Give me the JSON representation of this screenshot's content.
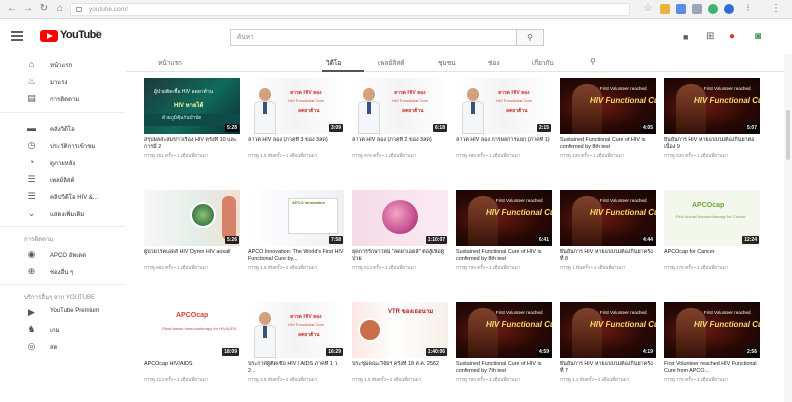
{
  "browser": {
    "url": "youtube.com/",
    "icons": [
      "back-icon",
      "forward-icon",
      "reload-icon",
      "home-icon",
      "star-icon",
      "menu-dots-icon"
    ]
  },
  "header": {
    "logo_text": "YouTube",
    "logo_sup": "TH",
    "search_value": "ค้นหา"
  },
  "sidebar": {
    "items": [
      {
        "label": "หน้าแรก",
        "icon": "home-icon"
      },
      {
        "label": "มาแรง",
        "icon": "trending-icon"
      },
      {
        "label": "การติดตาม",
        "icon": "subscriptions-icon"
      },
      {
        "label": "คลังวิดีโอ",
        "icon": "library-icon"
      },
      {
        "label": "ประวัติการเข้าชม",
        "icon": "history-icon"
      },
      {
        "label": "ดูภายหลัง",
        "icon": "watch-later-icon"
      },
      {
        "label": "เพลย์ลิสต์",
        "icon": "playlist-icon"
      },
      {
        "label": "คลิปวิดีโอ HIV &...",
        "icon": "playlist-icon"
      },
      {
        "label": "แสดงเพิ่มเติม",
        "icon": "chevron-down-icon"
      }
    ],
    "section_subs": "การติดตาม",
    "subs": [
      {
        "label": "APCO อัพเดต",
        "icon": "channel-avatar-icon"
      },
      {
        "label": "ช่องอื่น ๆ",
        "icon": "add-circle-icon"
      }
    ],
    "section_more": "บริการอื่นๆ จาก YOUTUBE",
    "more": [
      {
        "label": "YouTube Premium",
        "icon": "youtube-icon"
      },
      {
        "label": "เกม",
        "icon": "gaming-icon"
      },
      {
        "label": "สด",
        "icon": "live-icon"
      }
    ]
  },
  "tabs": [
    "หน้าแรก",
    "วิดีโอ",
    "เพลย์ลิสต์",
    "ชุมชน",
    "ช่อง",
    "เกี่ยวกับ"
  ],
  "videos": [
    {
      "title": "สรุปผลสะสมข่าวเรื่อง HIV ครั้งที่ 10 และการมี 2",
      "meta": "การดู 251 ครั้ง • 1 เดือนที่ผ่านมา",
      "duration": "5:28",
      "thumb": "a"
    },
    {
      "title": "ลาวต HIV ลอง (ภาคที่ 3 ของ 3ลด)",
      "meta": "การดู 1.5 พันครั้ง • 1 เดือนที่ผ่านมา",
      "duration": "3:09",
      "thumb": "doc"
    },
    {
      "title": "ลาวต HIV ลอง (ภาคที่ 2 ของ 3ลด)",
      "meta": "การดู 979 ครั้ง • 1 เดือนที่ผ่านมา",
      "duration": "6:18",
      "thumb": "doc"
    },
    {
      "title": "ลาวต HIV ลอง การผลการแยก (ภาคที่ 1)",
      "meta": "การดู 488 ครั้ง • 1 เดือนที่ผ่านมา",
      "duration": "2:15",
      "thumb": "doc"
    },
    {
      "title": "Sustained Functional Cure of HIV is confirmed by 8th test",
      "meta": "การดู 239 ครั้ง • 1 เดือนที่ผ่านมา",
      "duration": "4:05",
      "thumb": "dark"
    },
    {
      "title": "ยืนยันการ HIV หายแบบไม่ต้องกินยาต่อเนื่อง 9",
      "meta": "การดู 530 ครั้ง • 1 เดือนที่ผ่านมา",
      "duration": "5:07",
      "thumb": "dark"
    },
    {
      "title": "ผู้ป่วยโรคเอดส์ HIV Dyren HIV aoxall",
      "meta": "การดู 692 ครั้ง • 1 เดือนที่ผ่านมา",
      "duration": "5:26",
      "thumb": "lab"
    },
    {
      "title": "APCO Innovation: The World's First HIV Functional Cure by...",
      "meta": "การดู 1.6 พันครั้ง • 2 เดือนที่ผ่านมา",
      "duration": "7:58",
      "thumb": "slides"
    },
    {
      "title": "ยุคการรักษาใหม่ \"ลดยาเอดส์\" ต่อสู้เพื่อผู้ป่วย",
      "meta": "การดู 513 ครั้ง • 2 เดือนที่ผ่านมา",
      "duration": "1:10:07",
      "thumb": "pink"
    },
    {
      "title": "Sustained Functional Cure of HIV is confirmed by 8th test",
      "meta": "การดู 709 ครั้ง • 2 เดือนที่ผ่านมา",
      "duration": "6:41",
      "thumb": "dark"
    },
    {
      "title": "ยืนยันการ HIV หายแบบไม่ต้องกินยาครั้งที่ 8",
      "meta": "การดู 1 พันครั้ง • 2 เดือนที่ผ่านมา",
      "duration": "4:44",
      "thumb": "dark"
    },
    {
      "title": "APCOcap for Cancer",
      "meta": "การดู 275 ครั้ง • 2 เดือนที่ผ่านมา",
      "duration": "12:24",
      "thumb": "green"
    },
    {
      "title": "APCOcap HIV/AIDS",
      "meta": "การดู 213 ครั้ง • 2 เดือนที่ผ่านมา",
      "duration": "18:09",
      "thumb": "apcoC"
    },
    {
      "title": "ประกาศผู้ติดเชื้อ HIV / AIDS ภาคที่ 1 ว 2...",
      "meta": "การดู 2.9 พันครั้ง • 2 เดือนที่ผ่านมา",
      "duration": "16:29",
      "thumb": "doc"
    },
    {
      "title": "ประชุมคณะวิจัยฯ ครั้งที่ 18 ส.ค. 2562",
      "meta": "การดู 1.5 พันครั้ง • 2 เดือนที่ผ่านมา",
      "duration": "1:40:06",
      "thumb": "vtr"
    },
    {
      "title": "Sustained Functional Cure of HIV is confirmed by 7th test",
      "meta": "การดู 780 ครั้ง • 3 เดือนที่ผ่านมา",
      "duration": "4:59",
      "thumb": "dark"
    },
    {
      "title": "ยืนยันการ HIV หายแบบไม่ต้องกินยาครั้งที่ 7",
      "meta": "การดู 1.3 พันครั้ง • 3 เดือนที่ผ่านมา",
      "duration": "4:19",
      "thumb": "dark"
    },
    {
      "title": "First Volunteer reached HIV Functional Cure from APCO...",
      "meta": "การดู 775 ครั้ง • 3 เดือนที่ผ่านมา",
      "duration": "2:56",
      "thumb": "dark"
    }
  ]
}
